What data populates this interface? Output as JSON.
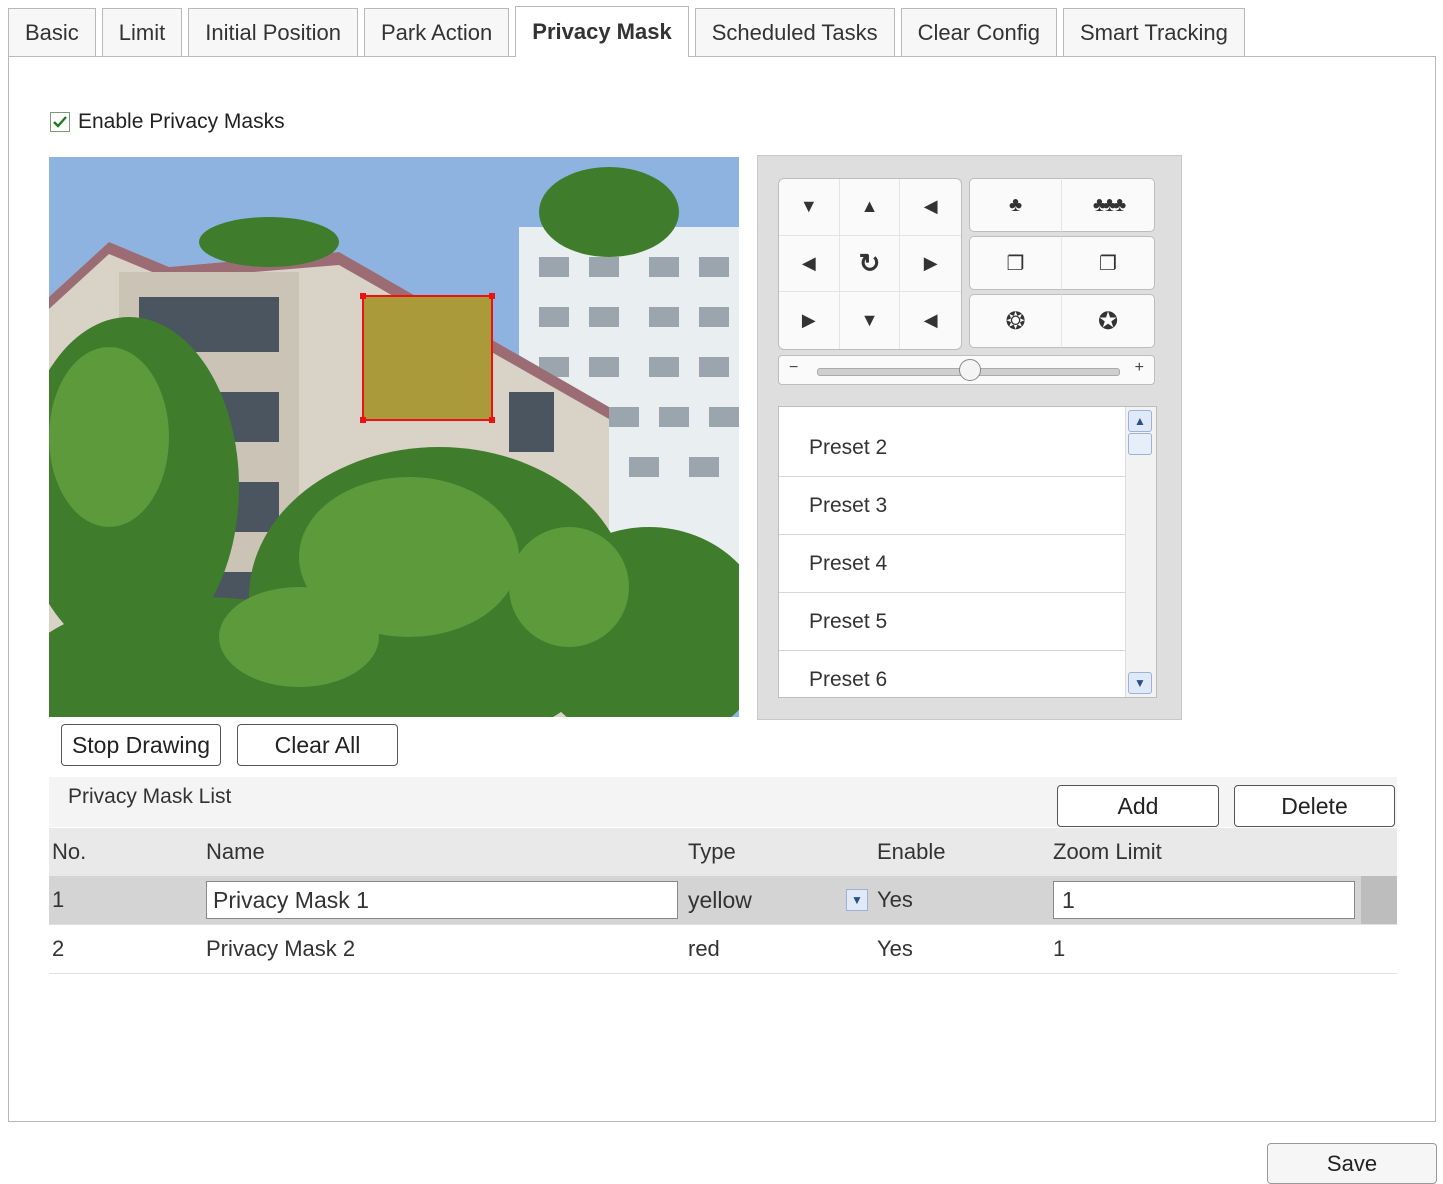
{
  "tabs": [
    "Basic",
    "Limit",
    "Initial Position",
    "Park Action",
    "Privacy Mask",
    "Scheduled Tasks",
    "Clear Config",
    "Smart Tracking"
  ],
  "active_tab": "Privacy Mask",
  "enable_privacy": {
    "label": "Enable Privacy Masks",
    "checked": true
  },
  "ptz": {
    "direction_glyphs": [
      "▼",
      "▲",
      "◀",
      "◀",
      "↻",
      "▶",
      "▶",
      "▼",
      "◀"
    ],
    "zoom_speed": 0.5,
    "presets": [
      "Preset 2",
      "Preset 3",
      "Preset 4",
      "Preset 5",
      "Preset 6"
    ]
  },
  "drawing": {
    "stop_label": "Stop Drawing",
    "clear_label": "Clear All"
  },
  "list": {
    "title": "Privacy Mask List",
    "add_label": "Add",
    "delete_label": "Delete",
    "columns": [
      "No.",
      "Name",
      "Type",
      "Enable",
      "Zoom Limit"
    ],
    "rows": [
      {
        "no": "1",
        "name": "Privacy Mask 1",
        "type": "yellow",
        "enable": "Yes",
        "zoom": "1"
      },
      {
        "no": "2",
        "name": "Privacy Mask 2",
        "type": "red",
        "enable": "Yes",
        "zoom": "1"
      }
    ]
  },
  "save_label": "Save",
  "colors": {
    "mask_fill": "#ab9a3a",
    "mask_border": "#ee1111"
  }
}
